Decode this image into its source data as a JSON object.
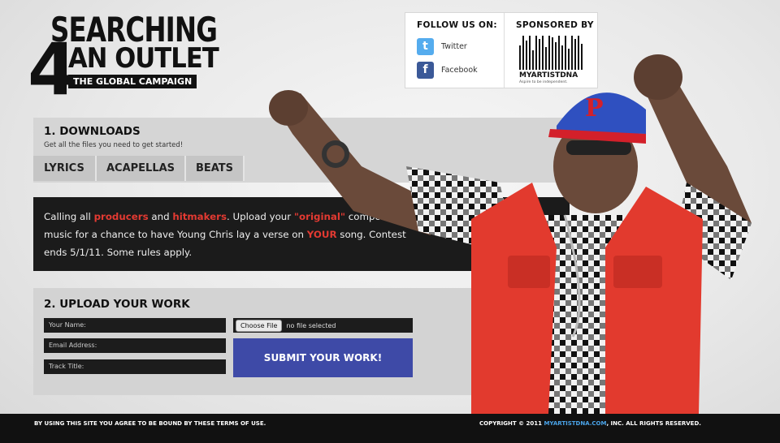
{
  "logo": {
    "line1": "SEARCHING",
    "line2": "AN OUTLET",
    "line3": "THE GLOBAL CAMPAIGN",
    "four": "4"
  },
  "social": {
    "follow_title": "FOLLOW US ON:",
    "links": [
      {
        "label": "Twitter",
        "icon": "twitter-icon",
        "color": "#55acee",
        "glyph": "t"
      },
      {
        "label": "Facebook",
        "icon": "facebook-icon",
        "color": "#3b5998",
        "glyph": "f"
      }
    ],
    "sponsor_title": "SPONSORED BY",
    "sponsor_brand": "MYARTISTDNA",
    "sponsor_tagline": "Aspire to be independent."
  },
  "downloads": {
    "title": "1. DOWNLOADS",
    "subtitle": "Get all the files you need to get started!",
    "tabs": [
      "LYRICS",
      "ACAPELLAS",
      "BEATS"
    ]
  },
  "contest": {
    "t1": "Calling all ",
    "r1": "producers",
    "t2": " and ",
    "r2": "hitmakers",
    "t3": ". Upload your ",
    "r3": "\"original\"",
    "t4": " composed music for a chance to have Young Chris lay a verse on ",
    "r4": "YOUR",
    "t5": " song. Contest ends 5/1/11. Some rules apply."
  },
  "upload": {
    "title": "2. UPLOAD YOUR WORK",
    "fields": [
      "Your Name:",
      "Email Address:",
      "Track Title:"
    ],
    "choose_file": "Choose File",
    "no_file": "no file selected",
    "submit": "SUBMIT YOUR WORK!"
  },
  "footer": {
    "left": "BY USING THIS SITE YOU AGREE TO BE BOUND BY THESE TERMS OF USE.",
    "right_prefix": "COPYRIGHT © 2011 ",
    "right_link": "MYARTISTDNA.COM",
    "right_suffix": ", INC. ALL RIGHTS RESERVED."
  },
  "colors": {
    "accent_red": "#e33a32",
    "submit_blue": "#3e4aa7",
    "footer_link": "#4aa3e8"
  }
}
